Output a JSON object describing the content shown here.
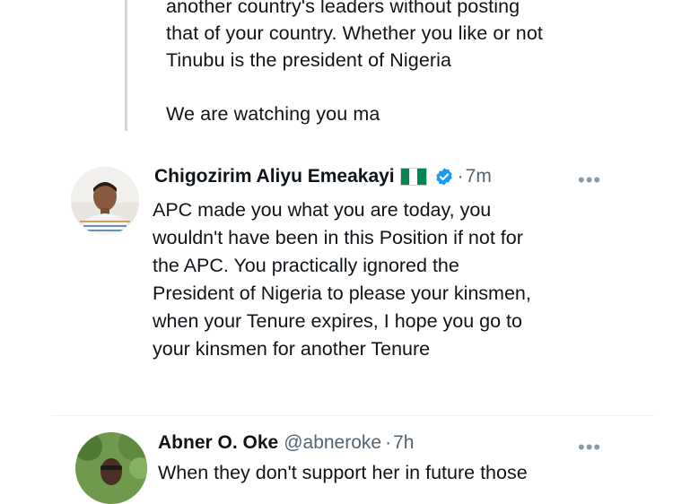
{
  "previous_tweet": {
    "lines": [
      "another country's leaders without posting",
      "that of your country. Whether you like or not",
      "Tinubu is the president of Nigeria",
      "We are watching you ma"
    ]
  },
  "tweets": [
    {
      "name": "Chigozirim Aliyu Emeakayi",
      "flag_emoji": "🇳🇬",
      "verified": true,
      "time": "7m",
      "dot": "·",
      "more": "•••",
      "lines": [
        "APC made you what you are today, you",
        "wouldn't have been in this Position if not for",
        "the APC. You practically ignored the",
        "President of Nigeria to please your kinsmen,",
        "when your Tenure expires, I hope you go to",
        "your kinsmen for another Tenure"
      ]
    },
    {
      "name": "Abner O. Oke",
      "handle": "@abneroke",
      "dot": "·",
      "time": "7h",
      "more": "•••",
      "lines": [
        "When they don't support her in future those"
      ]
    }
  ],
  "colors": {
    "text": "#0f1419",
    "secondary": "#536471",
    "verified": "#1d9bf0",
    "thread_line": "#cfd9de",
    "flag_green": "#008751"
  }
}
